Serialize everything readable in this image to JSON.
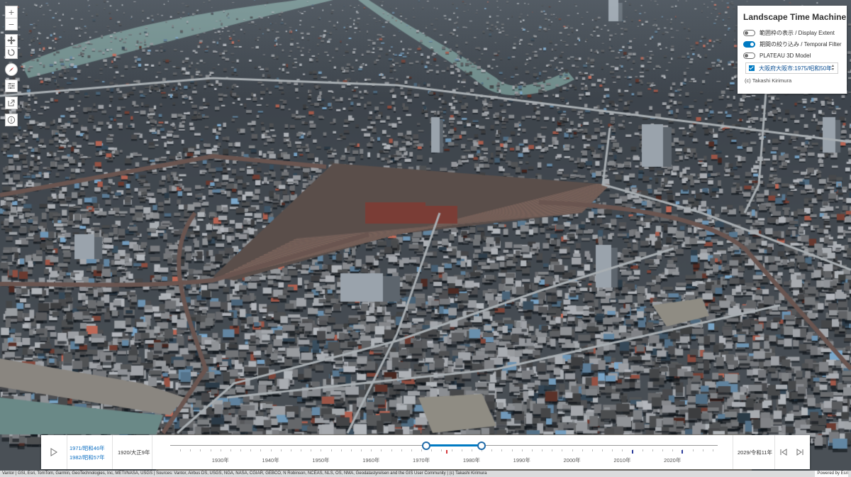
{
  "panel": {
    "title": "Landscape Time Machine",
    "options": [
      {
        "label": "範囲枠の表示 / Display Extent",
        "on": false
      },
      {
        "label": "期間の絞り込み / Temporal Filter",
        "on": true
      },
      {
        "label": "PLATEAU 3D Model",
        "on": false
      }
    ],
    "layer_label": "大阪府大阪市:1975/昭和50年",
    "credit": "(c) Takashi Kirimura"
  },
  "toolbar": {
    "zoom_in": "+",
    "zoom_out": "−",
    "icons": [
      "pan-icon",
      "rotate-icon",
      "compass-icon",
      "sliders-icon",
      "share-icon",
      "info-icon"
    ]
  },
  "time_slider": {
    "start_selected": "1971/昭和46年",
    "end_selected": "1982/昭和57年",
    "min_label": "1920/大正9年",
    "max_label": "2029/令和11年",
    "min_year": 1920,
    "max_year": 2029,
    "start_year": 1971,
    "end_year": 1982,
    "ticks": [
      "1930年",
      "1940年",
      "1950年",
      "1960年",
      "1970年",
      "1980年",
      "1990年",
      "2000年",
      "2010年",
      "2020年"
    ],
    "tick_years": [
      1930,
      1940,
      1950,
      1960,
      1970,
      1980,
      1990,
      2000,
      2010,
      2020
    ],
    "marks": [
      {
        "year": 1975,
        "color": "#d4373a"
      },
      {
        "year": 2012,
        "color": "#2c3c9a"
      },
      {
        "year": 2022,
        "color": "#2c3c9a"
      }
    ]
  },
  "attribution": {
    "text": "Vantor | GSI, Esri, TomTom, Garmin, GeoTechnologies, Inc, METI/NASA, USGS | Sources: Vantor, Airbus DS, USGS, NGA, NASA, CGIAR, GEBCO, N Robinson, NCEAS, NLS, OS, NMA, Geodatastyrelsen and the GIS User Community | (c) Takashi Kirimura",
    "powered": "Powered by Esri"
  },
  "colors": {
    "accent": "#007ac2",
    "highlight_mark": "#d4373a",
    "data_mark": "#2c3c9a"
  }
}
